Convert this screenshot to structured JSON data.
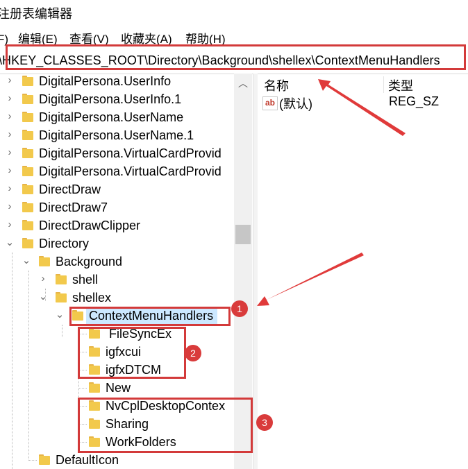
{
  "window": {
    "title": "注册表编辑器"
  },
  "menu": [
    {
      "label": "F)"
    },
    {
      "label": "编辑(E)"
    },
    {
      "label": "查看(V)"
    },
    {
      "label": "收藏夹(A)"
    },
    {
      "label": "帮助(H)"
    }
  ],
  "address": {
    "path": "\\HKEY_CLASSES_ROOT\\Directory\\Background\\shellex\\ContextMenuHandlers"
  },
  "tree": {
    "items": [
      {
        "label": "DigitalPersona.UserInfo"
      },
      {
        "label": "DigitalPersona.UserInfo.1"
      },
      {
        "label": "DigitalPersona.UserName"
      },
      {
        "label": "DigitalPersona.UserName.1"
      },
      {
        "label": "DigitalPersona.VirtualCardProvid"
      },
      {
        "label": "DigitalPersona.VirtualCardProvid"
      },
      {
        "label": "DirectDraw"
      },
      {
        "label": "DirectDraw7"
      },
      {
        "label": "DirectDrawClipper"
      },
      {
        "label": "Directory"
      },
      {
        "label": "Background"
      },
      {
        "label": "shell"
      },
      {
        "label": "shellex"
      },
      {
        "label": "ContextMenuHandlers"
      },
      {
        "label": "FileSyncEx"
      },
      {
        "label": "igfxcui"
      },
      {
        "label": "igfxDTCM"
      },
      {
        "label": "New"
      },
      {
        "label": "NvCplDesktopContex"
      },
      {
        "label": "Sharing"
      },
      {
        "label": "WorkFolders"
      },
      {
        "label": "DefaultIcon"
      }
    ]
  },
  "values_pane": {
    "col_name": "名称",
    "col_type": "类型",
    "rows": [
      {
        "name": "(默认)",
        "type": "REG_SZ",
        "icon": "string-value-icon"
      }
    ]
  },
  "annotations": {
    "badge1": "1",
    "badge2": "2",
    "badge3": "3",
    "color": "#d33a3a"
  }
}
